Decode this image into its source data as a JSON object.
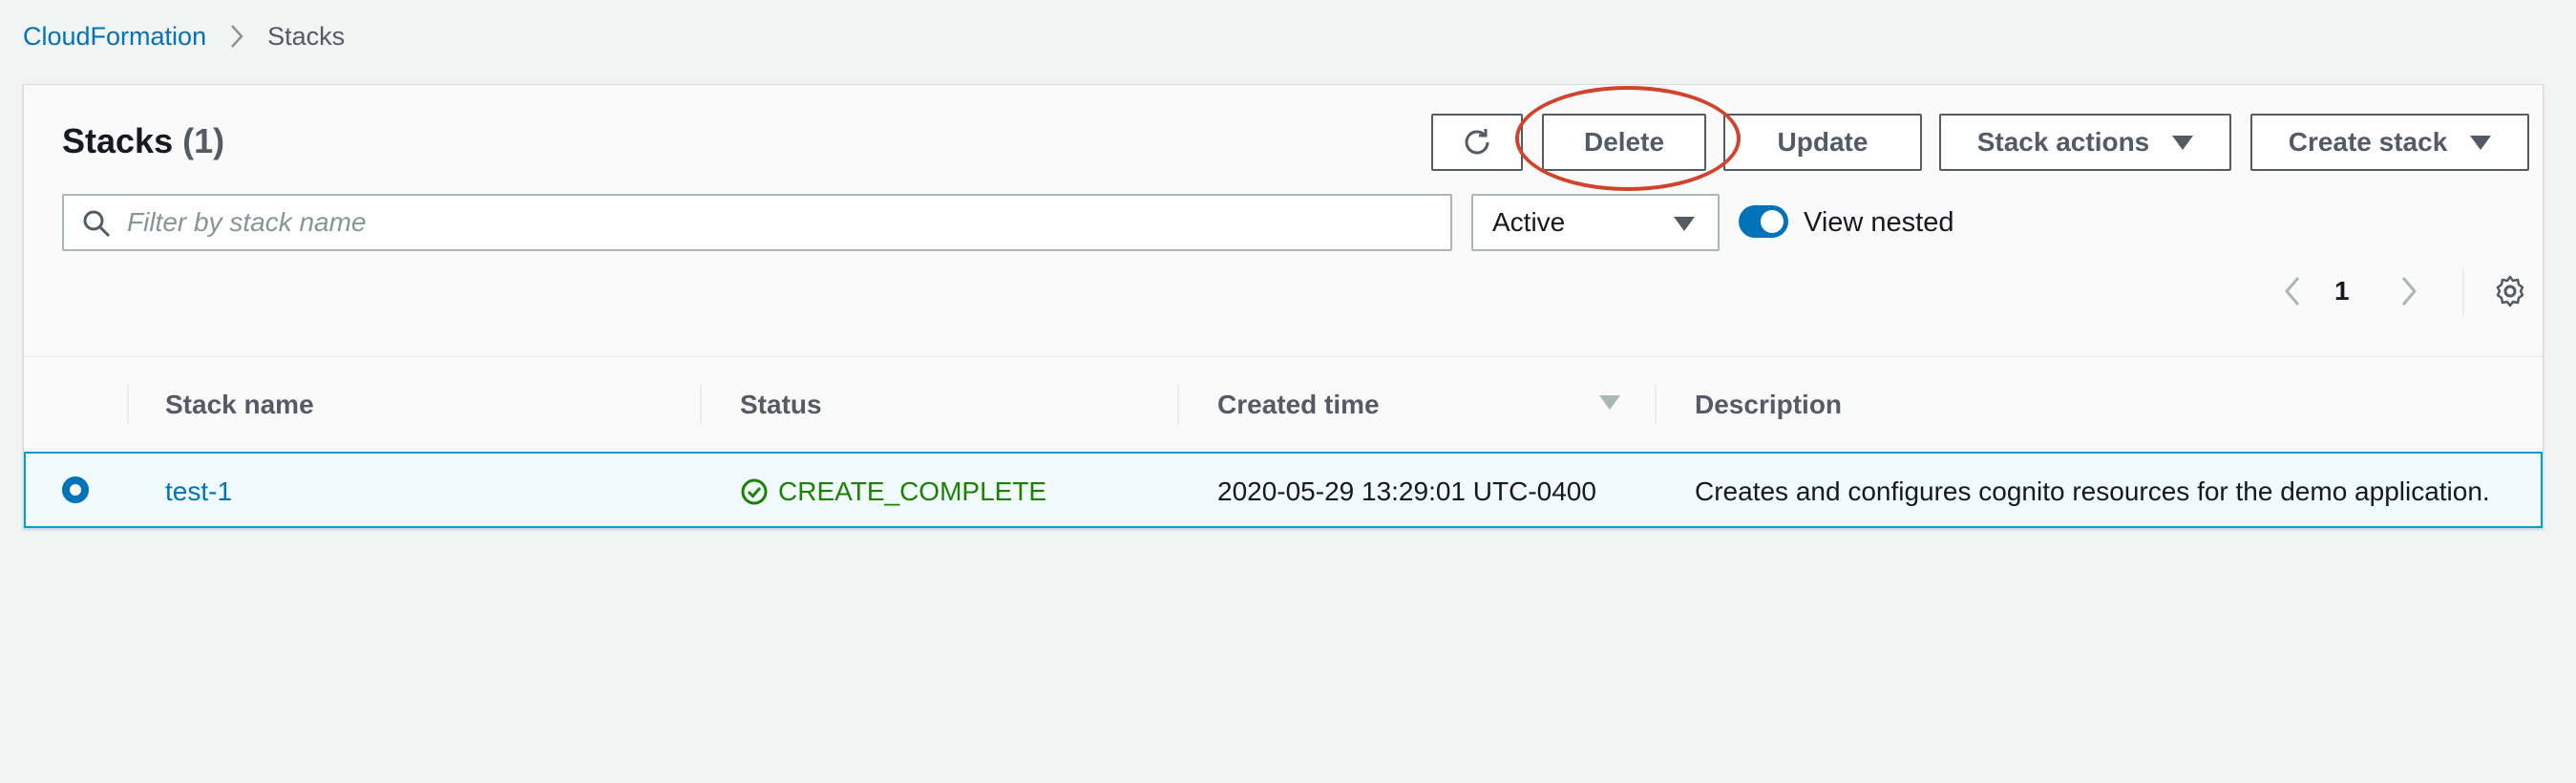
{
  "breadcrumb": {
    "root": "CloudFormation",
    "current": "Stacks"
  },
  "panel": {
    "title": "Stacks",
    "count": "(1)"
  },
  "toolbar": {
    "delete_label": "Delete",
    "update_label": "Update",
    "stack_actions_label": "Stack actions",
    "create_stack_label": "Create stack"
  },
  "filter": {
    "placeholder": "Filter by stack name",
    "value": ""
  },
  "status_filter": {
    "selected": "Active"
  },
  "nested_toggle": {
    "label": "View nested",
    "on": true
  },
  "pagination": {
    "current_page": "1"
  },
  "table": {
    "columns": [
      "Stack name",
      "Status",
      "Created time",
      "Description"
    ],
    "sorted_column": "Created time",
    "rows": [
      {
        "selected": true,
        "stack_name": "test-1",
        "status": "CREATE_COMPLETE",
        "created_time": "2020-05-29 13:29:01 UTC-0400",
        "description": "Creates and configures cognito resources for the demo application."
      }
    ]
  },
  "colors": {
    "link": "#0073bb",
    "success": "#1d8102",
    "annotation": "#d1432c",
    "selected_row_bg": "#f1faff",
    "selected_row_border": "#00a1c9"
  },
  "icons": [
    "chevron-right-icon",
    "refresh-icon",
    "caret-down-icon",
    "search-icon",
    "chevron-left-icon",
    "gear-icon",
    "check-circle-icon",
    "sort-descending-icon"
  ]
}
